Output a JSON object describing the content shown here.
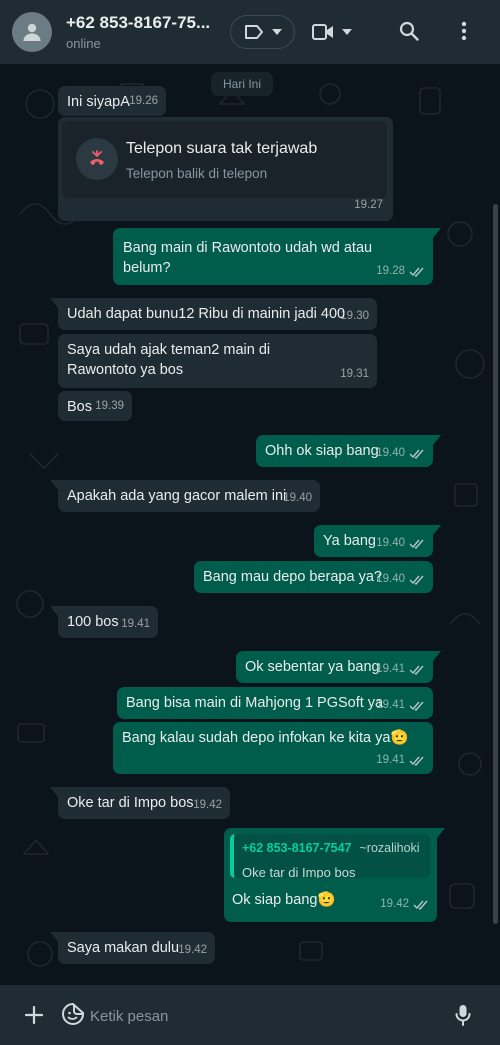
{
  "header": {
    "contact_name": "+62 853-8167-75...",
    "status": "online"
  },
  "chat": {
    "date_chip": "Hari Ini",
    "call": {
      "title": "Telepon suara tak terjawab",
      "subtitle": "Telepon balik di telepon",
      "time": "19.27"
    },
    "messages": [
      {
        "dir": "in",
        "text": "Ini siyapA",
        "time": "19.26"
      },
      {
        "dir": "out",
        "text": "Bang main di Rawontoto udah wd atau belum?",
        "time": "19.28"
      },
      {
        "dir": "in",
        "text": "Udah dapat bunu12 Ribu di mainin jadi 400",
        "time": "19.30"
      },
      {
        "dir": "in",
        "text": "Saya udah ajak teman2 main di Rawontoto ya bos",
        "time": "19.31"
      },
      {
        "dir": "in",
        "text": "Bos",
        "time": "19.39"
      },
      {
        "dir": "out",
        "text": "Ohh ok siap bang",
        "time": "19.40"
      },
      {
        "dir": "in",
        "text": "Apakah ada yang gacor malem ini",
        "time": "19.40"
      },
      {
        "dir": "out",
        "text": "Ya bang",
        "time": "19.40"
      },
      {
        "dir": "out",
        "text": "Bang mau depo berapa ya?",
        "time": "19.40"
      },
      {
        "dir": "in",
        "text": "100 bos",
        "time": "19.41"
      },
      {
        "dir": "out",
        "text": "Ok sebentar ya bang",
        "time": "19.41"
      },
      {
        "dir": "out",
        "text": "Bang bisa main di Mahjong 1 PGSoft ya",
        "time": "19.41"
      },
      {
        "dir": "out",
        "text": "Bang kalau sudah depo infokan ke kita ya",
        "emoji": "🫡",
        "time": "19.41"
      },
      {
        "dir": "in",
        "text": "Oke tar di Impo bos",
        "time": "19.42"
      },
      {
        "dir": "out",
        "text": "Ok siap bang",
        "emoji": "🫡",
        "time": "19.42",
        "quote": {
          "author": "+62 853-8167-7547",
          "pushname": "~rozalihoki",
          "text": "Oke tar di Impo bos"
        }
      },
      {
        "dir": "in",
        "text": "Saya makan dulu",
        "time": "19.42"
      }
    ]
  },
  "footer": {
    "placeholder": "Ketik pesan"
  },
  "colors": {
    "header_bg": "#202c33",
    "incoming_bubble": "#202c33",
    "outgoing_bubble": "#005c4b",
    "accent": "#06cf9c",
    "missed_call": "#f15c6d"
  },
  "icons": [
    "person-icon",
    "label-icon",
    "chevron-down-icon",
    "video-icon",
    "search-icon",
    "menu-dots-icon",
    "missed-call-icon",
    "double-check-icon",
    "plus-icon",
    "sticker-icon",
    "mic-icon"
  ]
}
